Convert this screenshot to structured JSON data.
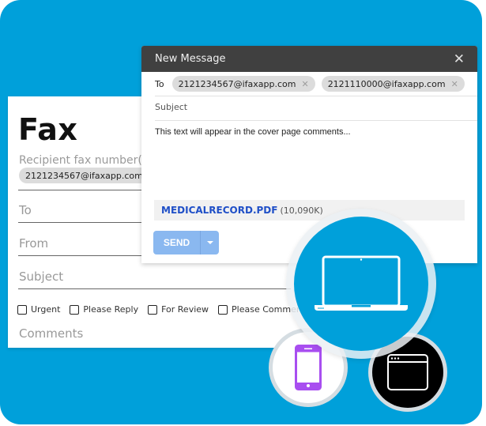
{
  "colors": {
    "background": "#00a0da",
    "header": "#404040",
    "attachment_link": "#1f4fc7",
    "send_button": "#8ab8f0",
    "phone_icon": "#a84ef0"
  },
  "fax_form": {
    "title": "Fax",
    "recipient_label": "Recipient fax number(U",
    "recipient_chip": "2121234567@ifaxapp.com",
    "fields": [
      "To",
      "From",
      "Subject"
    ],
    "checkboxes": [
      "Urgent",
      "Please Reply",
      "For Review",
      "Please Comment"
    ],
    "comments_label": "Comments"
  },
  "message": {
    "title": "New Message",
    "to_label": "To",
    "recipients": [
      "2121234567@ifaxapp.com",
      "2121110000@ifaxapp.com"
    ],
    "subject_placeholder": "Subject",
    "body": "This text will appear in the cover page comments...",
    "attachment": {
      "name": "MEDICALRECORD.PDF",
      "size": "(10,090K)"
    },
    "send_label": "SEND"
  },
  "chip_remove_glyph": "✕",
  "close_glyph": "✕",
  "devices": [
    "laptop-icon",
    "smartphone-icon",
    "browser-window-icon"
  ]
}
